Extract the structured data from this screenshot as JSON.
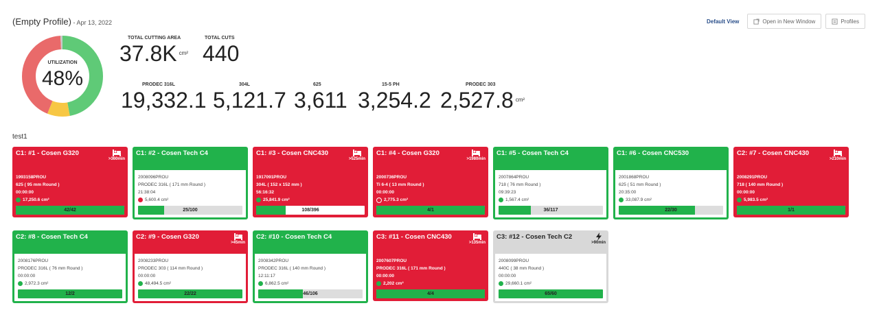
{
  "header": {
    "title": "(Empty Profile)",
    "date": " - Apr 13, 2022",
    "default_view": "Default View",
    "open_new_window": "Open in New Window",
    "profiles": "Profiles"
  },
  "utilization": {
    "label": "UTILIZATION",
    "value": "48%",
    "segments": [
      {
        "color": "#5fca77",
        "fraction": 0.47
      },
      {
        "color": "#f7c744",
        "fraction": 0.09
      },
      {
        "color": "#e96a6a",
        "fraction": 0.43
      },
      {
        "color": "#c8c8c8",
        "fraction": 0.01
      }
    ]
  },
  "totals": {
    "area_label": "TOTAL CUTTING AREA",
    "area_value": "37.8K",
    "area_unit": "cm²",
    "cuts_label": "TOTAL CUTS",
    "cuts_value": "440"
  },
  "materials": [
    {
      "label": "PRODEC 316L",
      "value": "19,332.1"
    },
    {
      "label": "304L",
      "value": "5,121.7"
    },
    {
      "label": "625",
      "value": "3,611"
    },
    {
      "label": "15-5 PH",
      "value": "3,254.2"
    },
    {
      "label": "PRODEC 303",
      "value": "2,527.8"
    }
  ],
  "materials_unit": "cm²",
  "section": "test1",
  "cards": [
    {
      "title": "C1: #1 - Cosen G320",
      "status": "red",
      "badge": "bed",
      "badge_text": ">360min",
      "job": "1993158PROU",
      "material": "625 ( 95 mm Round )",
      "time": "00:00:00",
      "dot": "green",
      "area": "17,250.6 cm²",
      "progress": "42/42",
      "fraction": 1.0
    },
    {
      "title": "C1: #2 - Cosen Tech C4",
      "status": "green",
      "badge": "",
      "badge_text": "",
      "job": "2008096PROU",
      "material": "PRODEC 316L ( 171 mm Round )",
      "time": "21:38:04",
      "dot": "red",
      "area": "5,600.4 cm²",
      "progress": "25/100",
      "fraction": 0.25
    },
    {
      "title": "C1: #3 - Cosen CNC430",
      "status": "red",
      "badge": "bed",
      "badge_text": ">525min",
      "job": "1917091PROU",
      "material": "304L ( 152 x 152 mm )",
      "time": "56:16:32",
      "dot": "green",
      "area": "25,841.9 cm²",
      "progress": "108/396",
      "fraction": 0.27
    },
    {
      "title": "C1: #4 - Cosen G320",
      "status": "red",
      "badge": "bed",
      "badge_text": ">1980min",
      "job": "2000736PROU",
      "material": "Ti 6-4 ( 13 mm Round )",
      "time": "00:00:00",
      "dot": "empty",
      "area": "2,775.3 cm²",
      "progress": "4/1",
      "fraction": 1.0
    },
    {
      "title": "C1: #5 - Cosen Tech C4",
      "status": "green",
      "badge": "",
      "badge_text": "",
      "job": "2007864PROU",
      "material": "718 ( 76 mm Round )",
      "time": "09:39:23",
      "dot": "green",
      "area": "1,567.4 cm²",
      "progress": "36/117",
      "fraction": 0.31
    },
    {
      "title": "C1: #6 - Cosen CNC530",
      "status": "green",
      "badge": "",
      "badge_text": "",
      "job": "2001868PROU",
      "material": "625 ( 51 mm Round )",
      "time": "20:35:00",
      "dot": "green",
      "area": "33,087.9 cm²",
      "progress": "22/30",
      "fraction": 0.73
    },
    {
      "title": "C2: #7 - Cosen CNC430",
      "status": "red",
      "badge": "bed",
      "badge_text": ">210min",
      "job": "2008291PROU",
      "material": "718 ( 140 mm Round )",
      "time": "00:00:00",
      "dot": "green",
      "area": "5,983.5 cm²",
      "progress": "1/1",
      "fraction": 1.0
    },
    {
      "title": "C2: #8 - Cosen Tech C4",
      "status": "green",
      "badge": "",
      "badge_text": "",
      "job": "2008176PROU",
      "material": "PRODEC 316L ( 76 mm Round )",
      "time": "00:00:00",
      "dot": "green",
      "area": "2,972.3 cm²",
      "progress": "12/2",
      "fraction": 1.0
    },
    {
      "title": "C2: #9 - Cosen G320",
      "status": "red-outline",
      "badge": "bed",
      "badge_text": ">45min",
      "job": "2008233PROU",
      "material": "PRODEC 303 ( 114 mm Round )",
      "time": "00:00:00",
      "dot": "green",
      "area": "48,494.5 cm²",
      "progress": "22/22",
      "fraction": 1.0
    },
    {
      "title": "C2: #10 - Cosen Tech C4",
      "status": "green",
      "badge": "",
      "badge_text": "",
      "job": "2008342PROU",
      "material": "PRODEC 316L ( 140 mm Round )",
      "time": "12:11:17",
      "dot": "green",
      "area": "6,862.5 cm²",
      "progress": "46/106",
      "fraction": 0.43
    },
    {
      "title": "C3: #11 - Cosen CNC430",
      "status": "red",
      "badge": "bed",
      "badge_text": ">135min",
      "job": "2007607PROU",
      "material": "PRODEC 316L ( 171 mm Round )",
      "time": "00:00:00",
      "dot": "green",
      "area": "2,202 cm²",
      "progress": "4/4",
      "fraction": 1.0
    },
    {
      "title": "C3: #12 - Cosen Tech C2",
      "status": "gray",
      "badge": "bolt",
      "badge_text": ">90min",
      "job": "2008099PROU",
      "material": "440C ( 38 mm Round )",
      "time": "00:00:00",
      "dot": "green",
      "area": "29,660.1 cm²",
      "progress": "65/60",
      "fraction": 1.0
    }
  ]
}
